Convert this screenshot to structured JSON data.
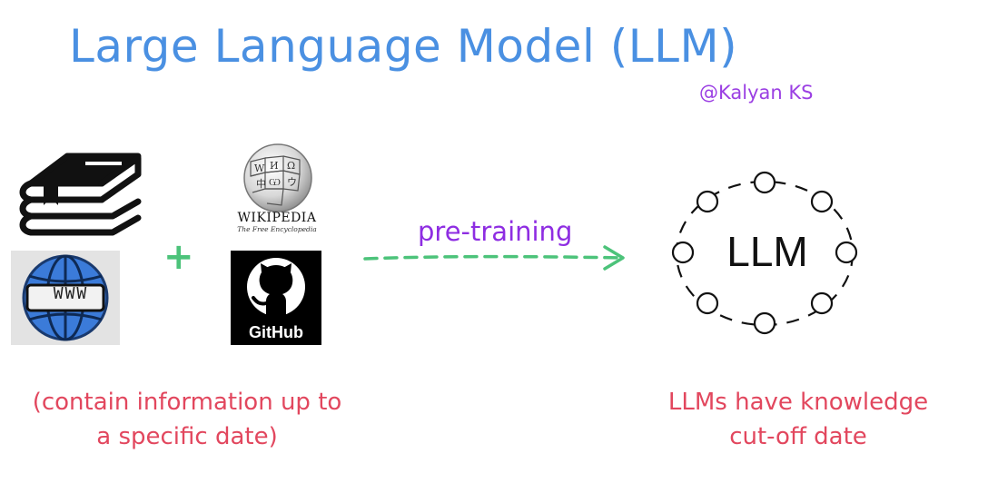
{
  "title": "Large Language Model (LLM)",
  "author": "@Kalyan KS",
  "sources": {
    "books_icon": "books-icon",
    "web_icon": "www-globe-icon",
    "web_label": "WWW",
    "plus": "+",
    "wikipedia_icon": "wikipedia-globe-icon",
    "wikipedia_wordmark": "Wikipedia",
    "wikipedia_tagline": "The Free Encyclopedia",
    "github_icon": "github-octocat-icon",
    "github_label": "GitHub"
  },
  "arrow_label": "pre-training",
  "llm_label": "LLM",
  "left_caption_line1": "(contain information up to",
  "left_caption_line2": "a specific date)",
  "right_caption_line1": "LLMs have knowledge",
  "right_caption_line2": "cut-off date",
  "colors": {
    "title": "#4a90e2",
    "author": "#9b3fe3",
    "arrow": "#4cc37a",
    "arrow_label": "#8e2de2",
    "captions": "#e2475e"
  }
}
